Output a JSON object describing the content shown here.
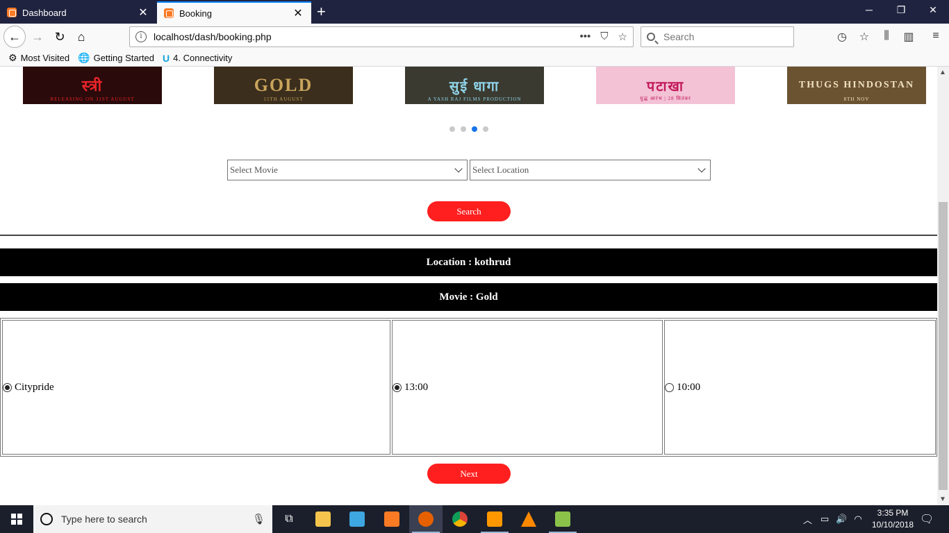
{
  "browser": {
    "tabs": [
      {
        "label": "Dashboard",
        "active": false
      },
      {
        "label": "Booking",
        "active": true
      }
    ],
    "url": "localhost/dash/booking.php",
    "url_actions": [
      "•••",
      "pocket-icon",
      "star-icon"
    ],
    "search_placeholder": "Search",
    "bookmarks": [
      {
        "label": "Most Visited",
        "icon": "gear-icon"
      },
      {
        "label": "Getting Started",
        "icon": "globe-icon"
      },
      {
        "label": "4. Connectivity",
        "icon": "u-logo-icon"
      }
    ]
  },
  "carousel": {
    "posters": [
      {
        "title": "स्त्री",
        "subtitle": "RELEASING ON 31ST AUGUST",
        "bg": "#2a0a0a",
        "color": "#e8232a"
      },
      {
        "title": "GOLD",
        "subtitle": "15TH AUGUST",
        "bg": "#3b2e1d",
        "color": "#c9a45c"
      },
      {
        "title": "सुई धागा",
        "subtitle": "A YASH RAJ FILMS PRODUCTION",
        "bg": "#3a3a30",
        "color": "#8fd3e8"
      },
      {
        "title": "पटाखा",
        "subtitle": "युद्ध आरंभ | 28 सितंबर",
        "bg": "#f3c2d4",
        "color": "#c2185b"
      },
      {
        "title": "THUGS HINDOSTAN",
        "subtitle": "8TH NOV",
        "bg": "#6b5231",
        "color": "#f0e2c0"
      }
    ],
    "dots": 4,
    "active_dot": 3
  },
  "form": {
    "movie_placeholder": "Select Movie",
    "location_placeholder": "Select Location",
    "search_button": "Search"
  },
  "result": {
    "location_label": "Location : kothrud",
    "movie_label": "Movie : Gold",
    "options": [
      {
        "label": "Citypride",
        "checked": true
      },
      {
        "label": "13:00",
        "checked": true
      },
      {
        "label": "10:00",
        "checked": false
      }
    ],
    "next_button": "Next"
  },
  "taskbar": {
    "search_placeholder": "Type here to search",
    "apps": [
      "task-view-icon",
      "file-explorer-icon",
      "media-player-icon",
      "xampp-icon",
      "firefox-icon",
      "chrome-icon",
      "sublime-icon",
      "vlc-icon",
      "notepad-icon"
    ],
    "time": "3:35 PM",
    "date": "10/10/2018"
  },
  "colors": {
    "accent_red": "#ff1f1f",
    "active_tab_border": "#0a84ff",
    "active_dot": "#1a73e8"
  }
}
